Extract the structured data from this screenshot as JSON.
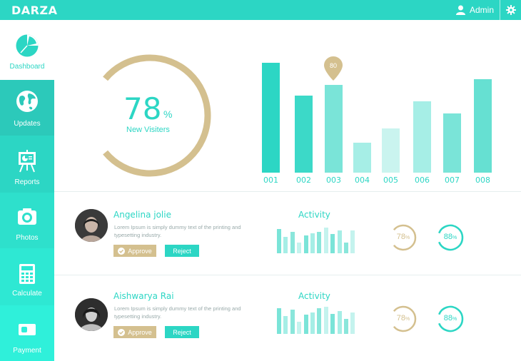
{
  "brand": "DARZA",
  "user": {
    "name": "Admin"
  },
  "colors": {
    "accent": "#2cd6c4",
    "gold": "#d4c08f"
  },
  "sidebar": {
    "items": [
      {
        "label": "Dashboard",
        "icon": "pie-chart-icon",
        "active": true
      },
      {
        "label": "Updates",
        "icon": "globe-icon"
      },
      {
        "label": "Reports",
        "icon": "presentation-board-icon"
      },
      {
        "label": "Photos",
        "icon": "camera-icon"
      },
      {
        "label": "Calculate",
        "icon": "calculator-icon"
      },
      {
        "label": "Payment",
        "icon": "card-icon"
      }
    ]
  },
  "visitors": {
    "value": "78",
    "unit": "%",
    "label": "New Visiters",
    "fraction": 0.78
  },
  "chart_data": {
    "type": "bar",
    "categories": [
      "001",
      "002",
      "003",
      "004",
      "005",
      "006",
      "007",
      "008"
    ],
    "values": [
      100,
      70,
      80,
      27,
      40,
      65,
      54,
      85
    ],
    "highlighted": {
      "category": "003",
      "label": "80"
    }
  },
  "people": [
    {
      "name": "Angelina jolie",
      "description": "Lorem Ipsum is simply dummy text of the printing and typesetting industry.",
      "approve_label": "Approve",
      "reject_label": "Reject",
      "activity_title": "Activity",
      "activity": [
        0.9,
        0.6,
        0.8,
        0.4,
        0.65,
        0.75,
        0.8,
        0.95,
        0.7,
        0.85,
        0.4,
        0.85
      ],
      "rings": [
        {
          "value": "78",
          "unit": "%",
          "fraction": 0.78,
          "color": "#d4c08f"
        },
        {
          "value": "88",
          "unit": "%",
          "fraction": 0.88,
          "color": "#2cd6c4"
        }
      ]
    },
    {
      "name": "Aishwarya Rai",
      "description": "Lorem Ipsum is simply dummy text of the printing and typesetting industry.",
      "approve_label": "Approve",
      "reject_label": "Reject",
      "activity_title": "Activity",
      "activity": [
        0.95,
        0.65,
        0.9,
        0.45,
        0.7,
        0.8,
        0.95,
        1.0,
        0.75,
        0.85,
        0.55,
        0.8
      ],
      "rings": [
        {
          "value": "78",
          "unit": "%",
          "fraction": 0.78,
          "color": "#d4c08f"
        },
        {
          "value": "88",
          "unit": "%",
          "fraction": 0.88,
          "color": "#2cd6c4"
        }
      ]
    }
  ]
}
